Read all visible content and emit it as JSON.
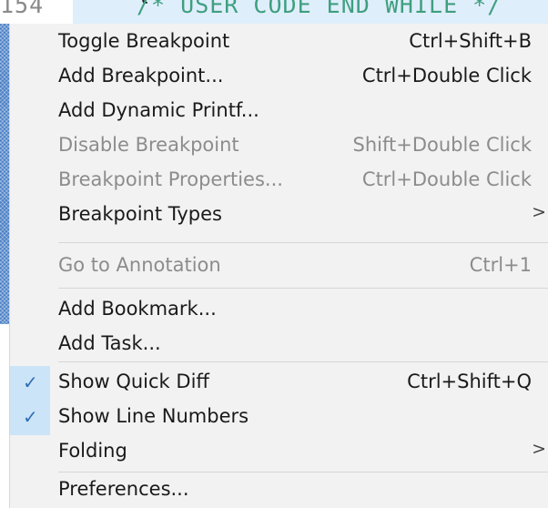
{
  "editor": {
    "line_number": "154",
    "code_line": "/* USER CODE END WHILE */",
    "brace": "{"
  },
  "menu": {
    "items": [
      {
        "label": "Toggle Breakpoint",
        "shortcut": "Ctrl+Shift+B",
        "enabled": true
      },
      {
        "label": "Add Breakpoint...",
        "shortcut": "Ctrl+Double Click",
        "enabled": true
      },
      {
        "label": "Add Dynamic Printf...",
        "shortcut": "",
        "enabled": true
      },
      {
        "label": "Disable Breakpoint",
        "shortcut": "Shift+Double Click",
        "enabled": false
      },
      {
        "label": "Breakpoint Properties...",
        "shortcut": "Ctrl+Double Click",
        "enabled": false
      },
      {
        "label": "Breakpoint Types",
        "submenu_arrow": ">",
        "enabled": true
      },
      {
        "label": "Go to Annotation",
        "shortcut": "Ctrl+1",
        "enabled": false
      },
      {
        "label": "Add Bookmark...",
        "shortcut": "",
        "enabled": true
      },
      {
        "label": "Add Task...",
        "shortcut": "",
        "enabled": true
      },
      {
        "label": "Show Quick Diff",
        "shortcut": "Ctrl+Shift+Q",
        "enabled": true,
        "checked": true,
        "check_glyph": "✓"
      },
      {
        "label": "Show Line Numbers",
        "shortcut": "",
        "enabled": true,
        "checked": true,
        "check_glyph": "✓"
      },
      {
        "label": "Folding",
        "submenu_arrow": ">",
        "enabled": true
      },
      {
        "label": "Preferences...",
        "shortcut": "",
        "enabled": true
      }
    ]
  },
  "colors": {
    "menu_background": "#f2f2f2",
    "disabled_text": "#8c8c8c",
    "check_highlight": "#cce4f7",
    "check_mark": "#2f6fb5",
    "code_comment": "#3f9f7f",
    "current_line": "#dfeefb"
  }
}
